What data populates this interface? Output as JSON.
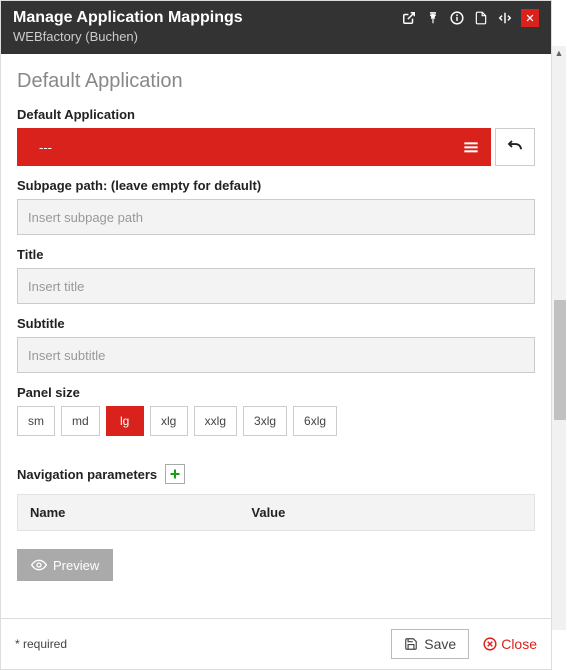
{
  "header": {
    "title": "Manage Application Mappings",
    "subtitle": "WEBfactory (Buchen)"
  },
  "section": {
    "heading": "Default Application"
  },
  "fields": {
    "default_app": {
      "label": "Default Application",
      "value": "---"
    },
    "subpage": {
      "label": "Subpage path: (leave empty for default)",
      "placeholder": "Insert subpage path"
    },
    "title": {
      "label": "Title",
      "placeholder": "Insert title"
    },
    "subtitle": {
      "label": "Subtitle",
      "placeholder": "Insert subtitle"
    },
    "panel_size": {
      "label": "Panel size",
      "options": [
        "sm",
        "md",
        "lg",
        "xlg",
        "xxlg",
        "3xlg",
        "6xlg"
      ],
      "active": "lg"
    }
  },
  "nav_params": {
    "label": "Navigation parameters",
    "cols": {
      "name": "Name",
      "value": "Value"
    }
  },
  "buttons": {
    "preview": "Preview",
    "save": "Save",
    "close": "Close"
  },
  "footer": {
    "required": "* required"
  }
}
